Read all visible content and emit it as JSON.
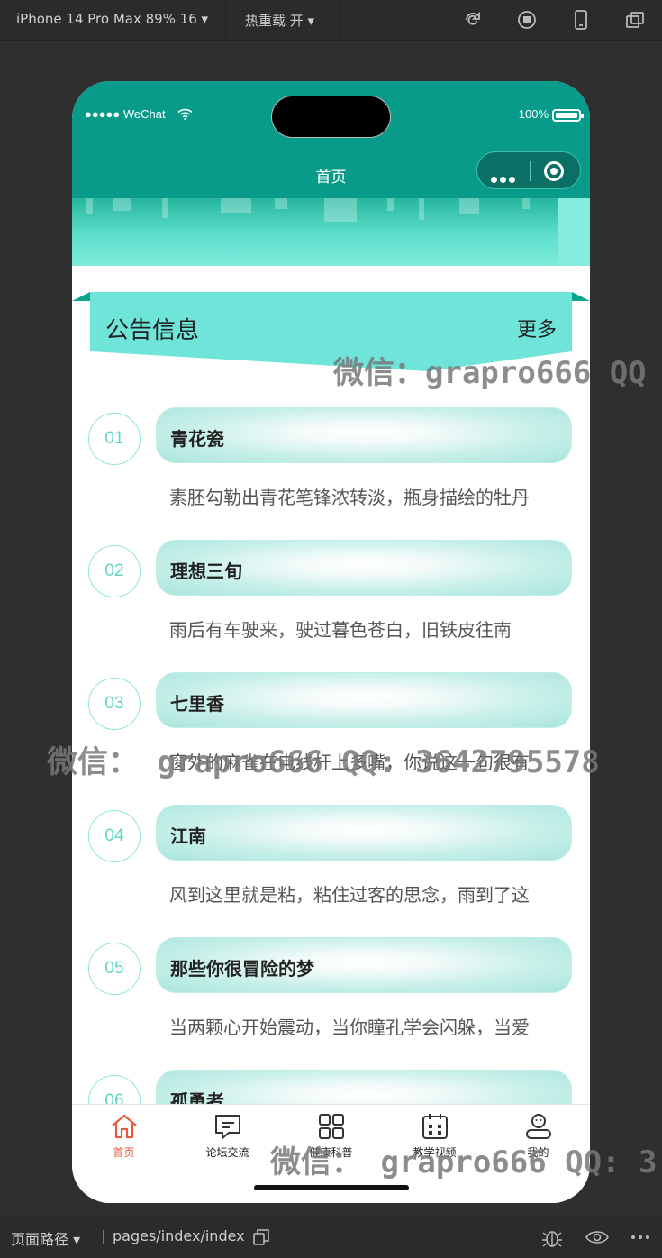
{
  "devtools": {
    "device_label": "iPhone 14 Pro Max 89% 16 ▾",
    "hot_reload_label": "热重载 开 ▾",
    "path_label": "页面路径 ▾",
    "path_value": "pages/index/index"
  },
  "status_bar": {
    "carrier": "●●●●● WeChat",
    "battery": "100%"
  },
  "navbar": {
    "title": "首页"
  },
  "notice": {
    "title": "公告信息",
    "more": "更多"
  },
  "items": [
    {
      "num": "01",
      "title": "青花瓷",
      "desc": "素胚勾勒出青花笔锋浓转淡，瓶身描绘的牡丹"
    },
    {
      "num": "02",
      "title": "理想三旬",
      "desc": "雨后有车驶来，驶过暮色苍白，旧铁皮往南"
    },
    {
      "num": "03",
      "title": "七里香",
      "desc": "窗外的麻雀在电线杆上多嘴，你说这一句很有"
    },
    {
      "num": "04",
      "title": "江南",
      "desc": "风到这里就是粘，粘住过客的思念，雨到了这"
    },
    {
      "num": "05",
      "title": "那些你很冒险的梦",
      "desc": "当两颗心开始震动，当你瞳孔学会闪躲，当爱"
    },
    {
      "num": "06",
      "title": "孤勇者",
      "desc": ""
    }
  ],
  "tabbar": {
    "tabs": [
      {
        "label": "首页",
        "icon": "home-icon"
      },
      {
        "label": "论坛交流",
        "icon": "chat-icon"
      },
      {
        "label": "健康科普",
        "icon": "grid-icon"
      },
      {
        "label": "教学视频",
        "icon": "calendar-icon"
      },
      {
        "label": "我的",
        "icon": "user-icon"
      }
    ],
    "active_color": "#e55a3c"
  },
  "watermarks": {
    "w1": "微信：grapro666 QQ",
    "w2": "微信： grapro666 QQ: 3642795578",
    "w3": "微信： grapro666 QQ: 3"
  },
  "colors": {
    "header": "#089b8a",
    "accent": "#6fe5d9"
  }
}
